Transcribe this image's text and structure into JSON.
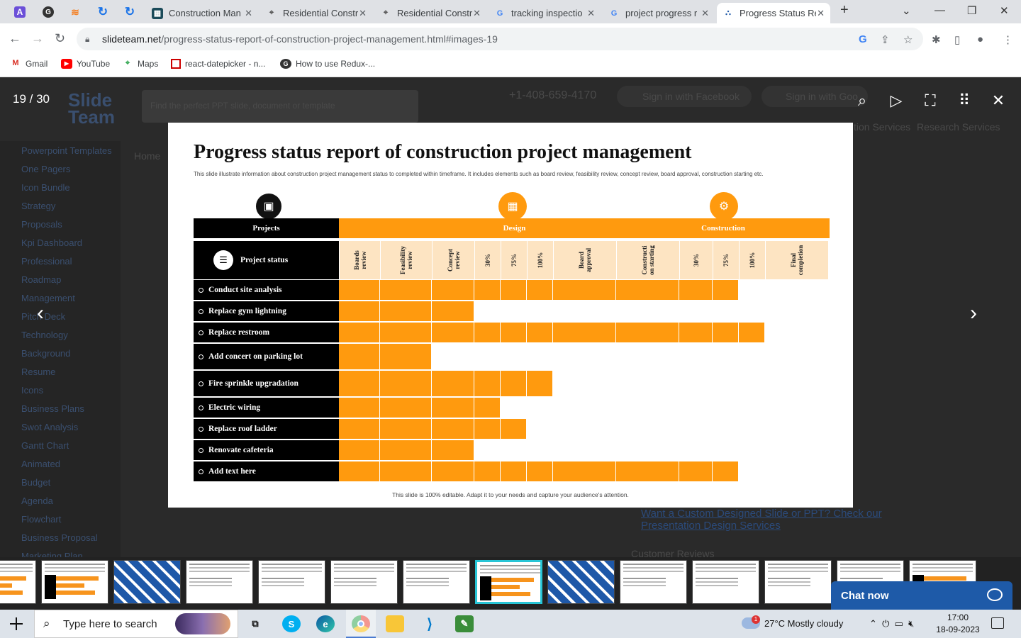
{
  "browser": {
    "pinned_tabs": [
      {
        "icon": "purple-app-icon",
        "color": "#6b4fd8",
        "glyph": "A"
      },
      {
        "icon": "github-icon",
        "color": "#333333",
        "glyph": "G"
      },
      {
        "icon": "stack-icon",
        "color": "#f48024",
        "glyph": "S"
      },
      {
        "icon": "refresh-blue-icon",
        "color": "#1a73e8",
        "glyph": "↻"
      },
      {
        "icon": "refresh-blue-icon",
        "color": "#1a73e8",
        "glyph": "↻"
      }
    ],
    "tabs": [
      {
        "title": "Construction Man",
        "icon": "grid-icon"
      },
      {
        "title": "Residential Constr",
        "icon": "location-icon"
      },
      {
        "title": "Residential Constr",
        "icon": "location-icon"
      },
      {
        "title": "tracking inspectio",
        "icon": "google-icon"
      },
      {
        "title": "project progress r",
        "icon": "google-icon"
      },
      {
        "title": "Progress Status Re",
        "icon": "slideteam-icon",
        "active": true
      }
    ],
    "new_tab": "+",
    "url_host": "slideteam.net",
    "url_path": "/progress-status-report-of-construction-project-management.html#images-19",
    "bookmarks": [
      "Gmail",
      "YouTube",
      "Maps",
      "react-datepicker - n...",
      "How to use Redux-..."
    ]
  },
  "background_page": {
    "sidebar_items": [
      "Powerpoint Templates",
      "One Pagers",
      "Icon Bundle",
      "Strategy",
      "Proposals",
      "Kpi Dashboard",
      "Professional",
      "Roadmap",
      "Management",
      "Pitch Deck",
      "Technology",
      "Background",
      "Resume",
      "Icons",
      "Business Plans",
      "Swot Analysis",
      "Gantt Chart",
      "Animated",
      "Budget",
      "Agenda",
      "Flowchart",
      "Business Proposal",
      "Marketing Plan"
    ],
    "phone": "+1-408-659-4170",
    "facebook": "Sign in with Facebook",
    "google": "Sign in with Goo",
    "search_placeholder": "Find the perfect PPT slide, document or template",
    "services": "tion Services",
    "research": "Research Services",
    "design_link": "Want a Custom Designed Slide or PPT? Check our Presentation Design Services",
    "reviews": "Customer Reviews",
    "breadcrumb": "Home"
  },
  "viewer": {
    "counter": "19 / 30",
    "prev": "‹",
    "next": "›"
  },
  "slide": {
    "title": "Progress status report of construction project management",
    "description": "This slide illustrate information about construction project management status to completed within timeframe. It includes elements such as board review, feasibility review, concept review, board approval, construction starting etc.",
    "footer": "This slide is 100% editable. Adapt it to your needs and capture your audience's attention.",
    "header_projects": "Projects",
    "header_design": "Design",
    "header_construction": "Construction",
    "project_status": "Project status",
    "accent": "#ff9a0e",
    "milestone_color": "#fde4c2"
  },
  "chart_data": {
    "type": "bar",
    "title": "Progress status report of construction project management",
    "milestones": [
      "Boards review",
      "Feasibility review",
      "Concept review",
      "30%",
      "75%",
      "100%",
      "Board approval",
      "Constructi on starting",
      "30%",
      "75%",
      "100%",
      "Final completion"
    ],
    "projects": [
      "Conduct site analysis",
      "Replace gym lightning",
      "Replace restroom",
      "Add concert on parking lot",
      "Fire sprinkle upgradation",
      "Electric wiring",
      "Replace roof ladder",
      "Renovate cafeteria",
      "Add text here"
    ],
    "values": [
      10,
      3,
      11,
      2,
      6,
      4,
      5,
      3,
      10
    ]
  },
  "thumbstrip": {
    "selected_index": 7,
    "count": 14
  },
  "chat": {
    "label": "Chat now"
  },
  "taskbar": {
    "search_placeholder": "Type here to search",
    "weather": "27°C  Mostly cloudy",
    "time": "17:00",
    "date": "18-09-2023",
    "badge": "1"
  }
}
